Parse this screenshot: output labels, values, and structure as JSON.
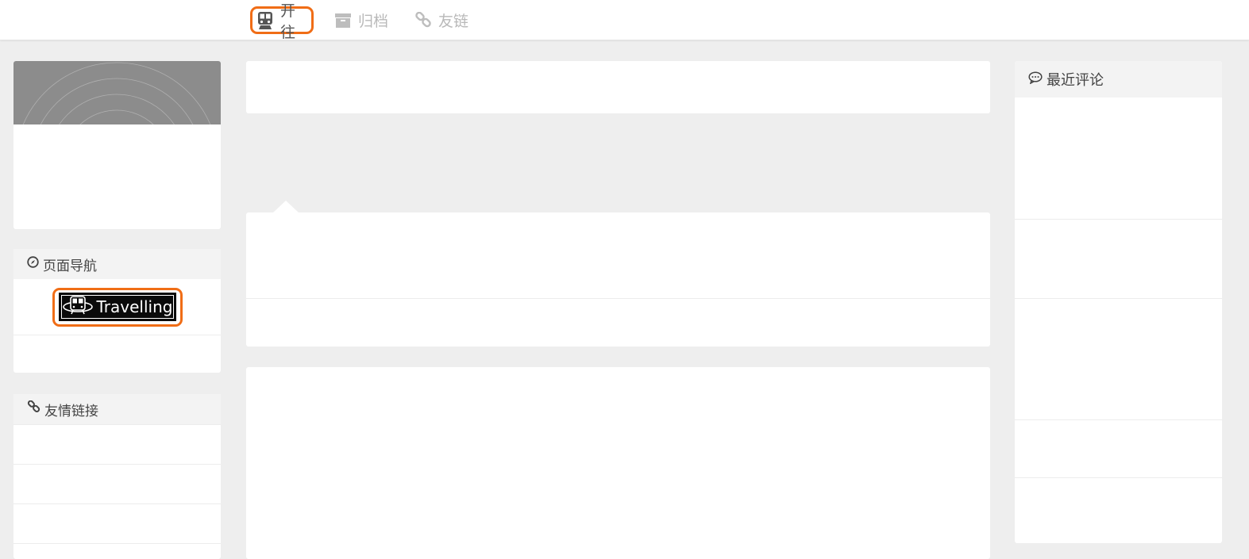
{
  "nav": {
    "items": [
      {
        "label": "开往",
        "icon": "train-icon"
      },
      {
        "label": "归档",
        "icon": "archive-icon"
      },
      {
        "label": "友链",
        "icon": "link-icon"
      }
    ]
  },
  "sidebar": {
    "page_nav": {
      "title": "页面导航",
      "icon": "compass-icon",
      "travelling_label": "Travelling"
    },
    "friends": {
      "title": "友情链接",
      "icon": "link-icon"
    }
  },
  "comments": {
    "title": "最近评论",
    "icon": "comment-icon"
  },
  "colors": {
    "accent": "#f06d16",
    "background": "#eeeeee",
    "card": "#ffffff",
    "banner": "#8c8c8c"
  }
}
